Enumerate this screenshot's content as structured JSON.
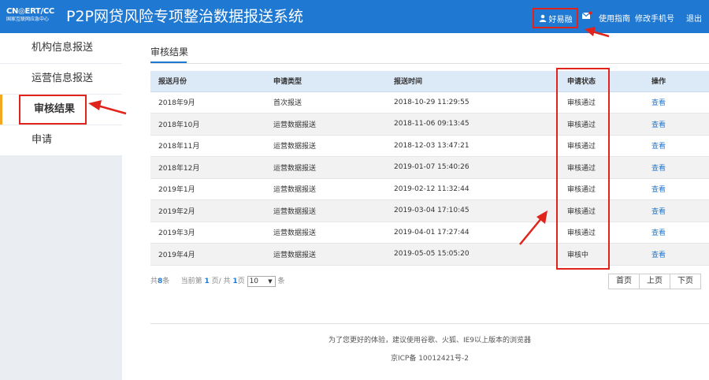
{
  "header": {
    "logo_main": "CN◎ERT/CC",
    "logo_sub": "国家互联网应急中心",
    "title": "P2P网贷风险专项整治数据报送系统",
    "user_name": "好易融",
    "guide_label": "使用指南",
    "change_phone_label": "修改手机号",
    "logout_label": "退出"
  },
  "sidebar": {
    "items": [
      {
        "label": "机构信息报送"
      },
      {
        "label": "运营信息报送"
      },
      {
        "label": "审核结果"
      },
      {
        "label": "申请"
      }
    ]
  },
  "main": {
    "tab_label": "审核结果",
    "columns": [
      "报送月份",
      "申请类型",
      "报送时间",
      "申请状态",
      "操作"
    ],
    "rows": [
      {
        "month": "2018年9月",
        "type": "首次报送",
        "time": "2018-10-29 11:29:55",
        "status": "审核通过",
        "action": "查看"
      },
      {
        "month": "2018年10月",
        "type": "运营数据报送",
        "time": "2018-11-06 09:13:45",
        "status": "审核通过",
        "action": "查看"
      },
      {
        "month": "2018年11月",
        "type": "运营数据报送",
        "time": "2018-12-03 13:47:21",
        "status": "审核通过",
        "action": "查看"
      },
      {
        "month": "2018年12月",
        "type": "运营数据报送",
        "time": "2019-01-07 15:40:26",
        "status": "审核通过",
        "action": "查看"
      },
      {
        "month": "2019年1月",
        "type": "运营数据报送",
        "time": "2019-02-12 11:32:44",
        "status": "审核通过",
        "action": "查看"
      },
      {
        "month": "2019年2月",
        "type": "运营数据报送",
        "time": "2019-03-04 17:10:45",
        "status": "审核通过",
        "action": "查看"
      },
      {
        "month": "2019年3月",
        "type": "运营数据报送",
        "time": "2019-04-01 17:27:44",
        "status": "审核通过",
        "action": "查看"
      },
      {
        "month": "2019年4月",
        "type": "运营数据报送",
        "time": "2019-05-05 15:05:20",
        "status": "审核中",
        "action": "查看"
      }
    ],
    "pager": {
      "total_prefix": "共",
      "total": "8",
      "total_suffix": "条",
      "current_prefix": "当前第",
      "current_page": "1",
      "pages_mid": "页/ 共",
      "total_pages": "1",
      "pages_suffix": "页",
      "page_size": "10",
      "size_suffix": "条",
      "first_label": "首页",
      "prev_label": "上页",
      "next_label": "下页"
    }
  },
  "footer": {
    "browser_tip": "为了您更好的体验，建议使用谷歌、火狐、IE9以上版本的浏览器",
    "icp": "京ICP备 10012421号-2"
  },
  "colors": {
    "header_bg": "#1f78d1",
    "annotation_red": "#e0241c",
    "active_marker": "#f5a623",
    "link": "#1f78d1"
  }
}
